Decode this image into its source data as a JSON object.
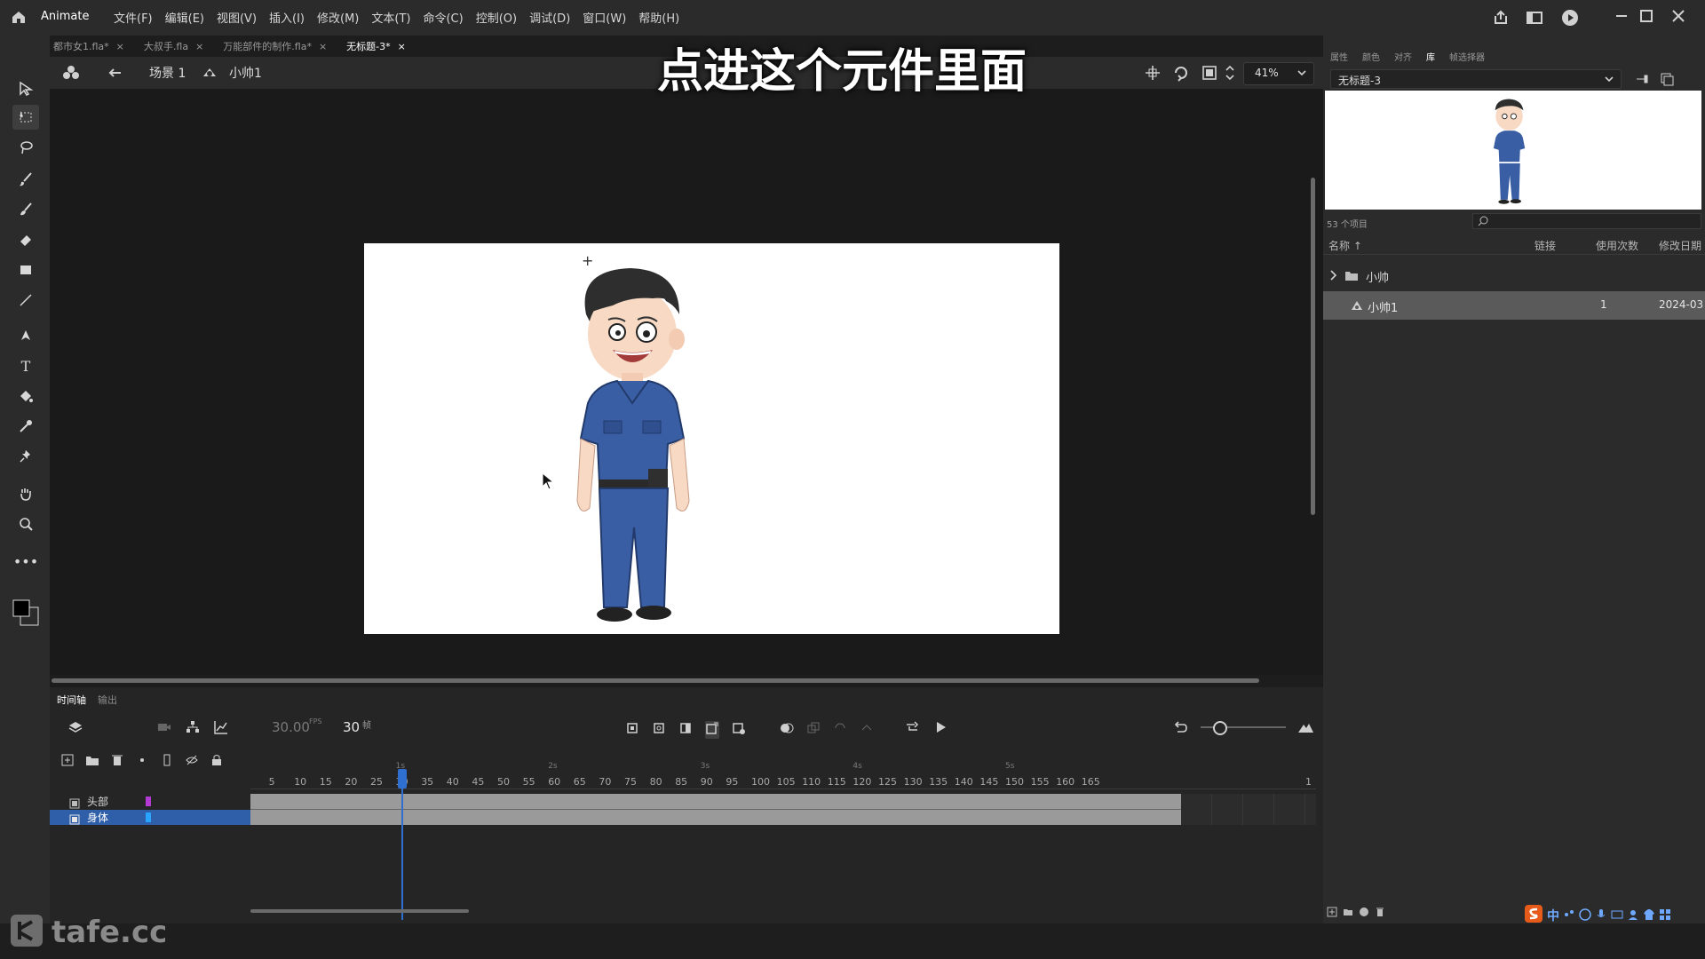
{
  "app": {
    "name": "Animate",
    "menu": [
      "文件(F)",
      "编辑(E)",
      "视图(V)",
      "插入(I)",
      "修改(M)",
      "文本(T)",
      "命令(C)",
      "控制(O)",
      "调试(D)",
      "窗口(W)",
      "帮助(H)"
    ]
  },
  "tabs": [
    {
      "label": "都市女1.fla*"
    },
    {
      "label": "大叔手.fla"
    },
    {
      "label": "万能部件的制作.fla*"
    },
    {
      "label": "无标题-3*"
    }
  ],
  "overlay": {
    "subtitle": "点进这个元件里面"
  },
  "stagebar": {
    "scene": "场景 1",
    "symbol": "小帅1",
    "zoom": "41%"
  },
  "right_panel": {
    "top_tabs": [
      "属性",
      "颜色",
      "对齐",
      "库",
      "帧选择器"
    ],
    "doc_select": "无标题-3",
    "items_count": "53 个项目",
    "columns": [
      "名称 ↑",
      "链接",
      "使用次数",
      "修改日期"
    ],
    "rows": [
      {
        "name": "小帅",
        "type": "folder",
        "count": "",
        "date": ""
      },
      {
        "name": "小帅1",
        "type": "symbol",
        "count": "1",
        "date": "2024-03"
      }
    ]
  },
  "timeline": {
    "tab_timeline": "时间轴",
    "tab_output": "输出",
    "fps": "30.00",
    "fps_unit": "FPS",
    "frame": "30",
    "frame_unit": "帧",
    "ruler": [
      "5",
      "10",
      "15",
      "20",
      "25",
      "30",
      "35",
      "40",
      "45",
      "50",
      "55",
      "60",
      "65",
      "70",
      "75",
      "80",
      "85",
      "90",
      "95",
      "100",
      "105",
      "110",
      "115",
      "120",
      "125",
      "130",
      "135",
      "140",
      "145",
      "150",
      "155",
      "160",
      "165",
      "1"
    ],
    "seconds": [
      "1s",
      "2s",
      "3s",
      "4s",
      "5s"
    ],
    "layers": [
      {
        "name": "头部",
        "color": "#b33bd3"
      },
      {
        "name": "身体",
        "color": "#29a4ff"
      }
    ]
  },
  "watermark": {
    "text": "tafe.cc"
  },
  "taskbar": {
    "ime": "中"
  }
}
